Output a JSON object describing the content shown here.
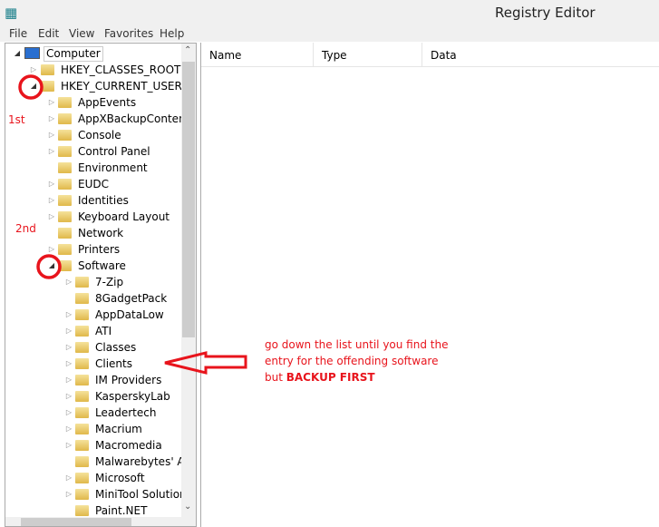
{
  "window": {
    "title": "Registry Editor",
    "icon": "registry-editor-icon"
  },
  "menu": [
    "File",
    "Edit",
    "View",
    "Favorites",
    "Help"
  ],
  "tree": [
    {
      "label": "Computer",
      "level": 0,
      "expander": "open",
      "icon": "computer-icon",
      "selected": true
    },
    {
      "label": "HKEY_CLASSES_ROOT",
      "level": 1,
      "expander": "closed"
    },
    {
      "label": "HKEY_CURRENT_USER",
      "level": 1,
      "expander": "open"
    },
    {
      "label": "AppEvents",
      "level": 2,
      "expander": "closed"
    },
    {
      "label": "AppXBackupContentType",
      "level": 2,
      "expander": "closed"
    },
    {
      "label": "Console",
      "level": 2,
      "expander": "closed"
    },
    {
      "label": "Control Panel",
      "level": 2,
      "expander": "closed"
    },
    {
      "label": "Environment",
      "level": 2,
      "expander": "none"
    },
    {
      "label": "EUDC",
      "level": 2,
      "expander": "closed"
    },
    {
      "label": "Identities",
      "level": 2,
      "expander": "closed"
    },
    {
      "label": "Keyboard Layout",
      "level": 2,
      "expander": "closed"
    },
    {
      "label": "Network",
      "level": 2,
      "expander": "none"
    },
    {
      "label": "Printers",
      "level": 2,
      "expander": "closed"
    },
    {
      "label": "Software",
      "level": 2,
      "expander": "open"
    },
    {
      "label": "7-Zip",
      "level": 3,
      "expander": "closed"
    },
    {
      "label": "8GadgetPack",
      "level": 3,
      "expander": "none"
    },
    {
      "label": "AppDataLow",
      "level": 3,
      "expander": "closed"
    },
    {
      "label": "ATI",
      "level": 3,
      "expander": "closed"
    },
    {
      "label": "Classes",
      "level": 3,
      "expander": "closed"
    },
    {
      "label": "Clients",
      "level": 3,
      "expander": "closed"
    },
    {
      "label": "IM Providers",
      "level": 3,
      "expander": "closed"
    },
    {
      "label": "KasperskyLab",
      "level": 3,
      "expander": "closed"
    },
    {
      "label": "Leadertech",
      "level": 3,
      "expander": "closed"
    },
    {
      "label": "Macrium",
      "level": 3,
      "expander": "closed"
    },
    {
      "label": "Macromedia",
      "level": 3,
      "expander": "closed"
    },
    {
      "label": "Malwarebytes' Anti-Malware",
      "level": 3,
      "expander": "none"
    },
    {
      "label": "Microsoft",
      "level": 3,
      "expander": "closed"
    },
    {
      "label": "MiniTool Solution",
      "level": 3,
      "expander": "closed"
    },
    {
      "label": "Paint.NET",
      "level": 3,
      "expander": "none"
    }
  ],
  "columns": [
    "Name",
    "Type",
    "Data"
  ],
  "annotations": {
    "first": "1st",
    "second": "2nd",
    "note_lines": [
      "go down the list until you find the",
      "entry for the offending software"
    ],
    "note_prefix": "but ",
    "note_bold": "BACKUP FIRST",
    "color": "#e8141c"
  }
}
